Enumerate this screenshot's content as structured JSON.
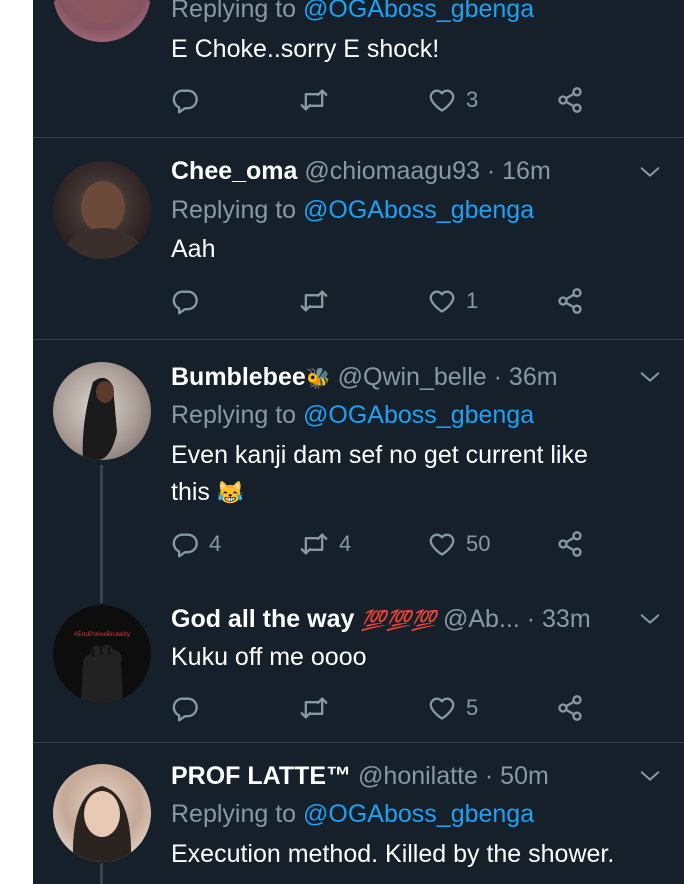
{
  "tweets": [
    {
      "display_name": "",
      "handle": "",
      "time": "",
      "replying_label": "Replying to",
      "replying_handle": "@OGAboss_gbenga",
      "text": "E Choke..sorry E shock!",
      "replies": "",
      "retweets": "",
      "likes": "3"
    },
    {
      "display_name": "Chee_oma",
      "handle": "@chiomaagu93",
      "time": "· 16m",
      "replying_label": "Replying to",
      "replying_handle": "@OGAboss_gbenga",
      "text": "Aah",
      "replies": "",
      "retweets": "",
      "likes": "1"
    },
    {
      "display_name": "Bumblebee",
      "name_emoji": "🐝",
      "handle": "@Qwin_belle",
      "time": "· 36m",
      "replying_label": "Replying to",
      "replying_handle": "@OGAboss_gbenga",
      "text_line1": "Even kanji dam sef no get current like",
      "text_line2": "this",
      "text_emoji": "😹",
      "replies": "4",
      "retweets": "4",
      "likes": "50"
    },
    {
      "display_name": "God all the way",
      "name_emoji": "💯💯💯",
      "handle": "@Ab...",
      "time": "· 33m",
      "text": "Kuku off me oooo",
      "avatar_text": "#EndPoliceBrutality",
      "replies": "",
      "retweets": "",
      "likes": "5"
    },
    {
      "display_name": "PROF LATTE™",
      "handle": "@honilatte",
      "time": "· 50m",
      "replying_label": "Replying to",
      "replying_handle": "@OGAboss_gbenga",
      "text": "Execution method. Killed by the shower."
    }
  ],
  "colors": {
    "background": "#15202b",
    "text": "#ffffff",
    "muted": "#8899a6",
    "link": "#1da1f2",
    "divider": "#38444d"
  },
  "icons": [
    "reply-icon",
    "retweet-icon",
    "like-icon",
    "share-icon",
    "chevron-down-icon"
  ]
}
